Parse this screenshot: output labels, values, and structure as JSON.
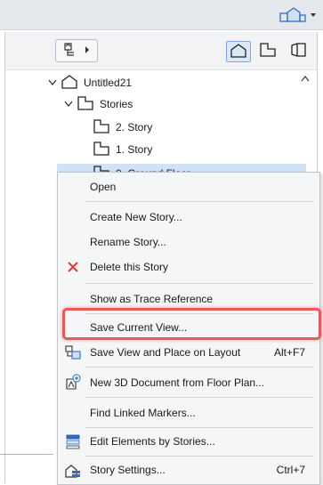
{
  "navigator": {
    "tree": [
      {
        "label": "Untitled21",
        "icon": "project-house-icon"
      },
      {
        "label": "Stories",
        "icon": "stories-icon"
      },
      {
        "label": "2. Story",
        "icon": "story-icon"
      },
      {
        "label": "1. Story",
        "icon": "story-icon"
      },
      {
        "label": "0. Ground Floor",
        "icon": "story-icon"
      }
    ]
  },
  "context_menu": {
    "items": [
      {
        "label": "Open",
        "shortcut": ""
      },
      {
        "label": "Create New Story...",
        "shortcut": ""
      },
      {
        "label": "Rename Story...",
        "shortcut": ""
      },
      {
        "label": "Delete this Story",
        "shortcut": "",
        "icon": "delete-x-icon"
      },
      {
        "label": "Show as Trace Reference",
        "shortcut": ""
      },
      {
        "label": "Save Current View...",
        "shortcut": ""
      },
      {
        "label": "Save View and Place on Layout",
        "shortcut": "Alt+F7",
        "icon": "save-view-layout-icon"
      },
      {
        "label": "New 3D Document from Floor Plan...",
        "shortcut": "",
        "icon": "new-3d-document-icon"
      },
      {
        "label": "Find Linked Markers...",
        "shortcut": ""
      },
      {
        "label": "Edit Elements by Stories...",
        "shortcut": "",
        "icon": "edit-by-stories-icon"
      },
      {
        "label": "Story Settings...",
        "shortcut": "Ctrl+7",
        "icon": "story-settings-icon"
      }
    ]
  },
  "colors": {
    "highlight": "#e85a5a",
    "delete_icon": "#e03b3b",
    "accent_blue": "#2e6fc4"
  }
}
